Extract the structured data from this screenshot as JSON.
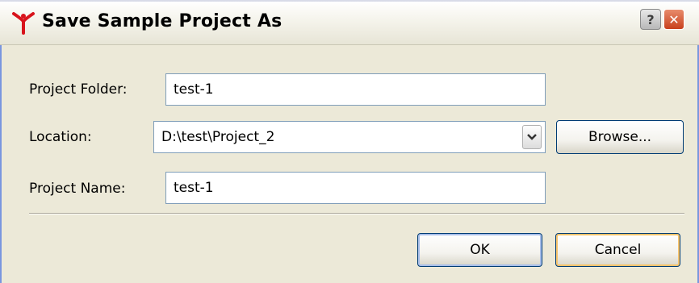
{
  "window": {
    "title": "Save Sample Project As",
    "help_label": "?",
    "close_label": "✕"
  },
  "form": {
    "project_folder": {
      "label": "Project Folder:",
      "value": "test-1"
    },
    "location": {
      "label": "Location:",
      "value": "D:\\test\\Project_2"
    },
    "project_name": {
      "label": "Project Name:",
      "value": "test-1"
    }
  },
  "buttons": {
    "browse_label": "Browse...",
    "ok_label": "OK",
    "cancel_label": "Cancel"
  },
  "colors": {
    "background": "#ece9d8",
    "logo_red": "#d8141c",
    "field_border": "#7f9db9"
  }
}
